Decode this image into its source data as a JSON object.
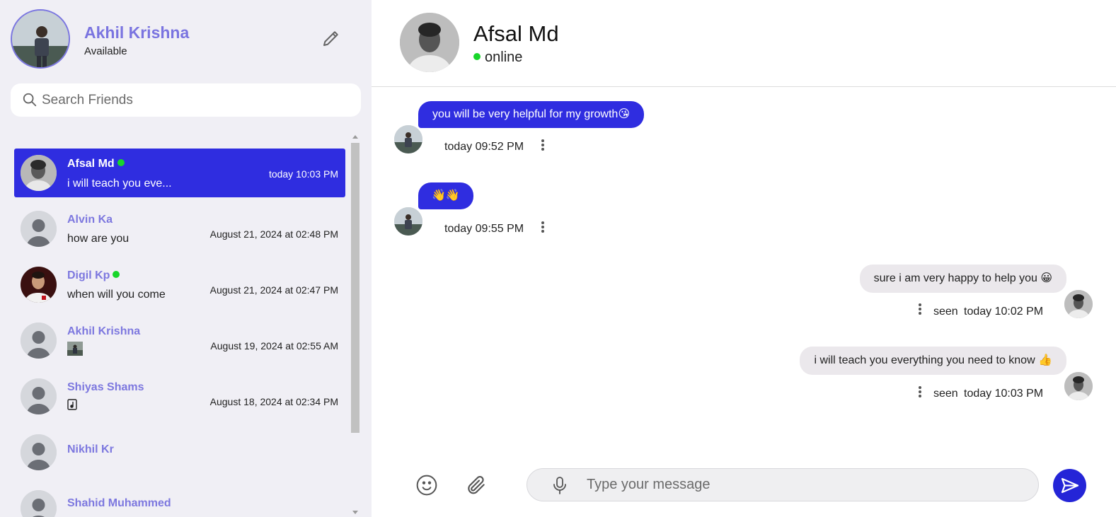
{
  "user": {
    "name": "Akhil Krishna",
    "status": "Available"
  },
  "search": {
    "placeholder": "Search Friends"
  },
  "friends": [
    {
      "name": "Afsal Md",
      "online": true,
      "last_message": "i will teach you eve...",
      "time": "today 10:03 PM",
      "active": true
    },
    {
      "name": "Alvin Ka",
      "online": false,
      "last_message": "how are you",
      "time": "August 21, 2024 at 02:48 PM"
    },
    {
      "name": "Digil Kp",
      "online": true,
      "last_message": "when will you come",
      "time": "August 21, 2024 at 02:47 PM"
    },
    {
      "name": "Akhil Krishna",
      "online": false,
      "last_message": "",
      "attachment": "image-thumbnail",
      "time": "August 19, 2024 at 02:55 AM"
    },
    {
      "name": "Shiyas Shams",
      "online": false,
      "last_message": "",
      "attachment": "document-icon",
      "time": "August 18, 2024 at 02:34 PM"
    },
    {
      "name": "Nikhil Kr",
      "online": false,
      "last_message": "",
      "time": ""
    },
    {
      "name": "Shahid Muhammed",
      "online": false,
      "last_message": "",
      "time": ""
    }
  ],
  "chat": {
    "contact_name": "Afsal Md",
    "contact_status": "online",
    "messages": [
      {
        "direction": "incoming",
        "text": "you will be very helpful for my growth😘",
        "time": "today 09:52 PM"
      },
      {
        "direction": "incoming",
        "text": "👋👋",
        "time": "today 09:55 PM"
      },
      {
        "direction": "outgoing",
        "text": "sure i am very happy to help you 😀",
        "receipt": "seen",
        "time": "today 10:02 PM"
      },
      {
        "direction": "outgoing",
        "text": "i will teach you everything you need to know 👍",
        "receipt": "seen",
        "time": "today 10:03 PM"
      }
    ]
  },
  "composer": {
    "placeholder": "Type your message"
  },
  "colors": {
    "accent": "#2f2de0",
    "name_purple": "#7d78df",
    "online_green": "#18d62a",
    "sidebar_bg": "#f0eff5"
  }
}
